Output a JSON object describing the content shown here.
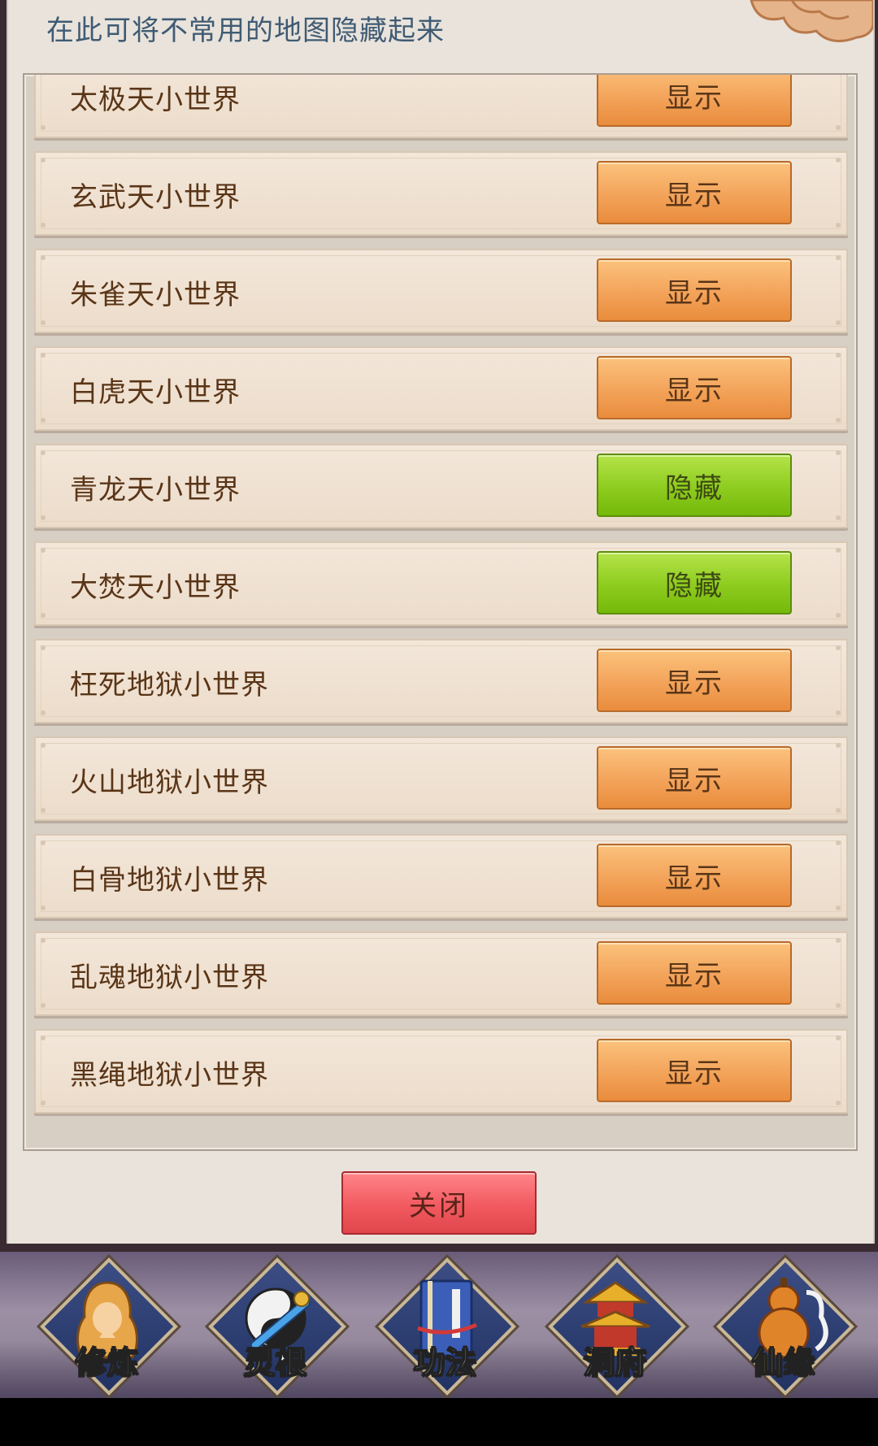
{
  "hint_text": "在此可将不常用的地图隐藏起来",
  "colors": {
    "show_button": "#f3a35a",
    "hide_button": "#8dcc1e",
    "close_button": "#f15a60",
    "label_text": "#5a3517",
    "hint_text": "#3f5b73"
  },
  "maps": [
    {
      "name": "太极天小世界",
      "button": "显示",
      "state": "show"
    },
    {
      "name": "玄武天小世界",
      "button": "显示",
      "state": "show"
    },
    {
      "name": "朱雀天小世界",
      "button": "显示",
      "state": "show"
    },
    {
      "name": "白虎天小世界",
      "button": "显示",
      "state": "show"
    },
    {
      "name": "青龙天小世界",
      "button": "隐藏",
      "state": "hide"
    },
    {
      "name": "大焚天小世界",
      "button": "隐藏",
      "state": "hide"
    },
    {
      "name": "枉死地狱小世界",
      "button": "显示",
      "state": "show"
    },
    {
      "name": "火山地狱小世界",
      "button": "显示",
      "state": "show"
    },
    {
      "name": "白骨地狱小世界",
      "button": "显示",
      "state": "show"
    },
    {
      "name": "乱魂地狱小世界",
      "button": "显示",
      "state": "show"
    },
    {
      "name": "黑绳地狱小世界",
      "button": "显示",
      "state": "show"
    }
  ],
  "close_label": "关闭",
  "bottom_nav": [
    {
      "label": "修炼",
      "icon": "monk-icon"
    },
    {
      "label": "灵根",
      "icon": "yin-yang-sword-icon"
    },
    {
      "label": "功法",
      "icon": "scripture-book-icon"
    },
    {
      "label": "洞府",
      "icon": "pagoda-icon"
    },
    {
      "label": "仙缘",
      "icon": "gourd-icon"
    }
  ]
}
